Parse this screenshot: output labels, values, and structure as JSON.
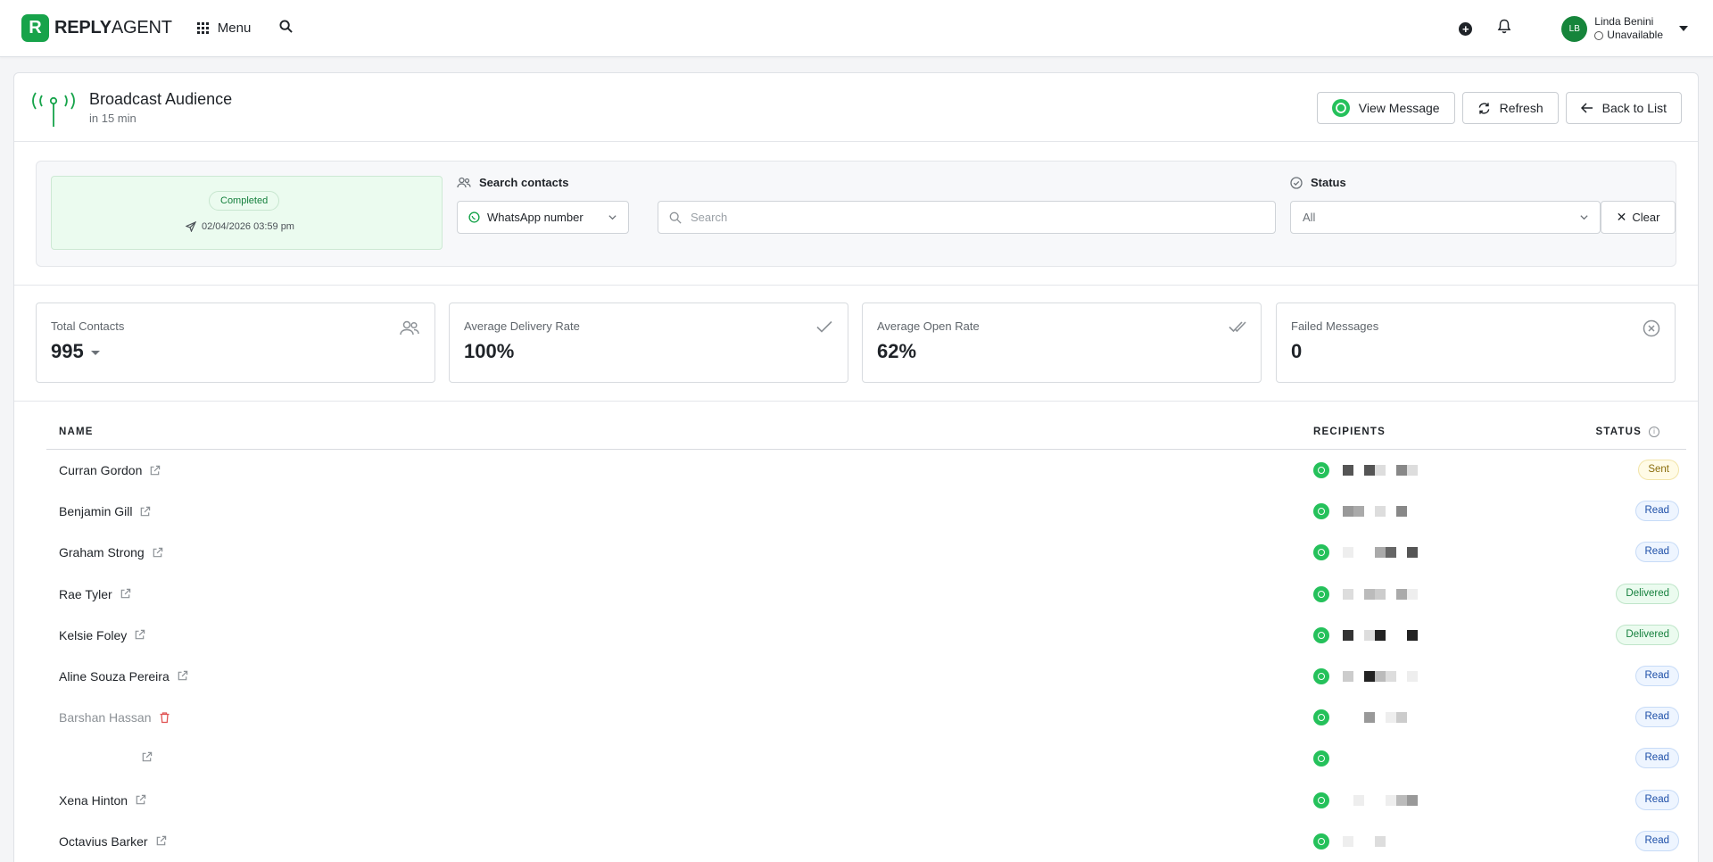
{
  "app": {
    "brand_bold": "REPLY",
    "brand_light": "AGENT",
    "menu_label": "Menu",
    "user": {
      "initials": "LB",
      "name": "Linda Benini",
      "status": "Unavailable"
    }
  },
  "header": {
    "title": "Broadcast Audience",
    "subtitle": "in 15 min",
    "buttons": {
      "view_message": "View Message",
      "refresh": "Refresh",
      "back": "Back to List"
    }
  },
  "filters": {
    "status_badge": "Completed",
    "sent_date": "02/04/2026 03:59 pm",
    "search_label": "Search contacts",
    "search_field": "WhatsApp number",
    "search_placeholder": "Search",
    "status_label": "Status",
    "status_value": "All",
    "clear_label": "Clear"
  },
  "stats": {
    "total_contacts_label": "Total Contacts",
    "total_contacts_value": "995",
    "delivery_label": "Average Delivery Rate",
    "delivery_value": "100%",
    "open_label": "Average Open Rate",
    "open_value": "62%",
    "failed_label": "Failed Messages",
    "failed_value": "0"
  },
  "table": {
    "columns": {
      "name": "NAME",
      "recipients": "RECIPIENTS",
      "status": "STATUS"
    },
    "rows": [
      {
        "name": "Curran Gordon",
        "status": "Sent"
      },
      {
        "name": "Benjamin Gill",
        "status": "Read"
      },
      {
        "name": "Graham Strong",
        "status": "Read"
      },
      {
        "name": "Rae Tyler",
        "status": "Delivered"
      },
      {
        "name": "Kelsie Foley",
        "status": "Delivered"
      },
      {
        "name": "Aline Souza Pereira",
        "status": "Read"
      },
      {
        "name": "Barshan Hassan",
        "status": "Read"
      },
      {
        "name": "",
        "status": "Read"
      },
      {
        "name": "Xena Hinton",
        "status": "Read"
      },
      {
        "name": "Octavius Barker",
        "status": "Read"
      }
    ]
  },
  "colors": {
    "brand": "#17a34a",
    "whatsapp": "#25c15b",
    "avatar": "#16853b"
  }
}
